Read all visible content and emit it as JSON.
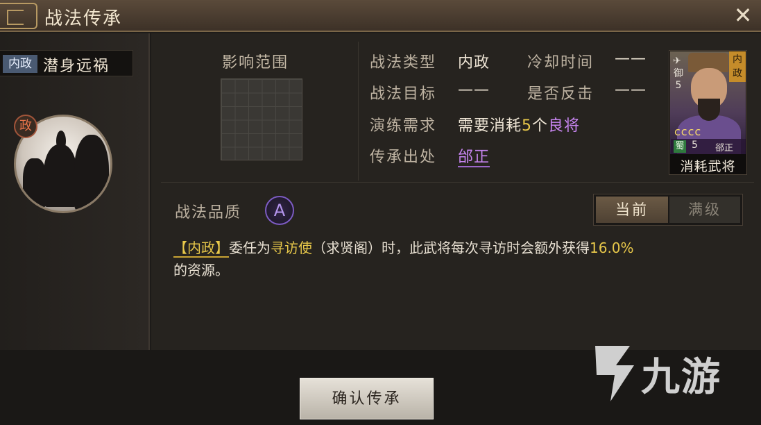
{
  "title": "战法传承",
  "close_glyph": "✕",
  "left": {
    "type_tag": "内政",
    "skill_name": "潜身远祸",
    "portrait_badge": "政"
  },
  "range": {
    "title": "影响范围"
  },
  "info": {
    "type_label": "战法类型",
    "type_value": "内政",
    "cooldown_label": "冷却时间",
    "cooldown_value": "——",
    "target_label": "战法目标",
    "target_value": "——",
    "counter_label": "是否反击",
    "counter_value": "——",
    "train_label": "演练需求",
    "train_value_pre": "需要消耗",
    "train_value_num": "5",
    "train_value_mid": "个",
    "train_value_link": "良将",
    "source_label": "传承出处",
    "source_value": "邰正"
  },
  "card": {
    "tag": "内政",
    "rank_icon": "✈",
    "rank_text": "御5",
    "stars": "ᴄᴄᴄᴄ",
    "faction": "蜀",
    "cost": "5",
    "name": "郤正",
    "caption": "消耗武将"
  },
  "quality": {
    "label": "战法品质",
    "grade": "A"
  },
  "toggle": {
    "current": "当前",
    "max": "满级"
  },
  "description": {
    "tag": "【内政】",
    "part1": "委任为",
    "role": "寻访使",
    "part2": "（求贤阁）时，此武将每次寻访时会额外获得",
    "percent": "16.0%",
    "part3": "的资源。"
  },
  "confirm_label": "确认传承",
  "watermark": "九游",
  "colors": {
    "accent_yellow": "#e8c84a",
    "accent_purple": "#c785f0",
    "grade_purple": "#7c5bc2"
  }
}
